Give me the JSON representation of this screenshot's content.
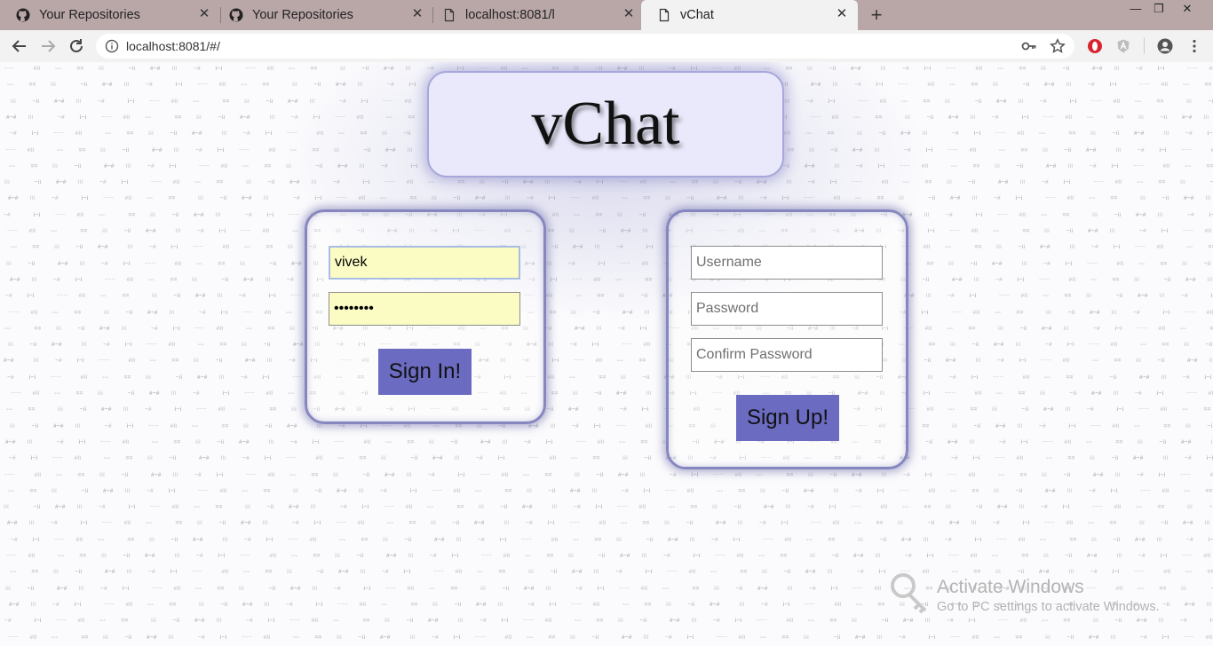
{
  "browser": {
    "tabs": [
      {
        "title": "Your Repositories",
        "icon": "github-icon",
        "active": false
      },
      {
        "title": "Your Repositories",
        "icon": "github-icon",
        "active": false
      },
      {
        "title": "localhost:8081/l",
        "icon": "page-icon",
        "active": false
      },
      {
        "title": "vChat",
        "icon": "page-icon",
        "active": true
      }
    ],
    "url": "localhost:8081/#/",
    "accent": "#b9a7a8"
  },
  "app": {
    "title": "vChat"
  },
  "signin": {
    "username_value": "vivek",
    "password_value": "vivek123",
    "button_label": "Sign In!"
  },
  "signup": {
    "username_placeholder": "Username",
    "password_placeholder": "Password",
    "confirm_placeholder": "Confirm Password",
    "button_label": "Sign Up!"
  },
  "colors": {
    "button": "#6b6bc2",
    "panel_border": "#8787c0",
    "autofill": "#fafcc4"
  },
  "watermark": {
    "title": "Activate Windows",
    "subtitle": "Go to PC settings to activate Windows."
  }
}
